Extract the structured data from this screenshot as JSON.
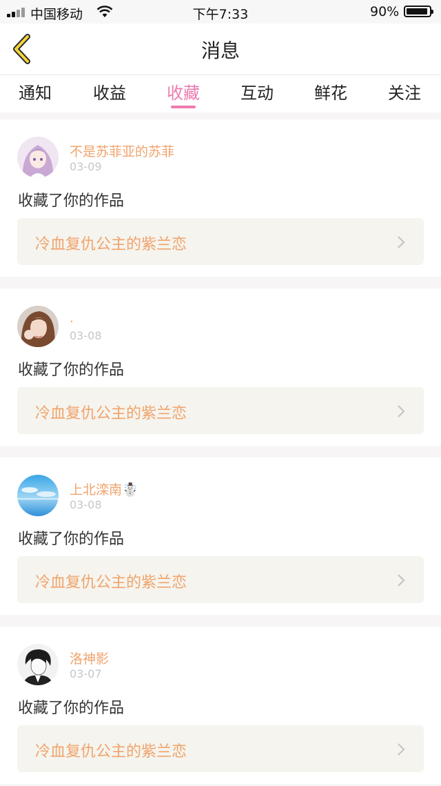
{
  "status_bar": {
    "carrier": "中国移动",
    "time": "下午7:33",
    "battery": "90%"
  },
  "nav": {
    "title": "消息"
  },
  "tabs": [
    {
      "label": "通知"
    },
    {
      "label": "收益"
    },
    {
      "label": "收藏"
    },
    {
      "label": "互动"
    },
    {
      "label": "鲜花"
    },
    {
      "label": "关注"
    }
  ],
  "active_tab": "收藏",
  "feed": [
    {
      "username": "不是苏菲亚的苏菲",
      "date": "03-09",
      "action": "收藏了你的作品",
      "work_title": "冷血复仇公主的紫兰恋",
      "avatar": "anime-girl-avatar"
    },
    {
      "username": ".",
      "date": "03-08",
      "action": "收藏了你的作品",
      "work_title": "冷血复仇公主的紫兰恋",
      "avatar": "woman-portrait-avatar"
    },
    {
      "username": "上北滦南☃️",
      "date": "03-08",
      "action": "收藏了你的作品",
      "work_title": "冷血复仇公主的紫兰恋",
      "avatar": "sky-sea-avatar"
    },
    {
      "username": "洛神影",
      "date": "03-07",
      "action": "收藏了你的作品",
      "work_title": "冷血复仇公主的紫兰恋",
      "avatar": "anime-boy-avatar"
    }
  ],
  "colors": {
    "accent_pink": "#ee7ab0",
    "username_orange": "#f0a36b",
    "work_box_bg": "#f5f4ee",
    "back_arrow": "#f5d53a"
  }
}
